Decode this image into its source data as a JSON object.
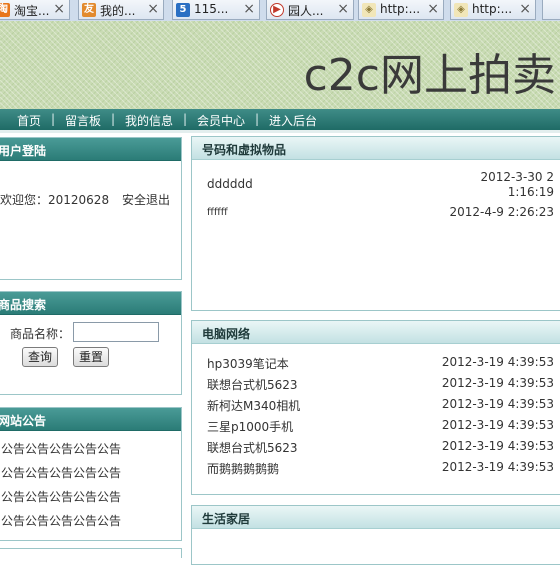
{
  "browser": {
    "tabs": [
      {
        "label": "淘宝...",
        "icon": "taobao-icon",
        "color": "#e8761b",
        "glyph": "淘"
      },
      {
        "label": "我的...",
        "icon": "browser-favicon-icon",
        "color": "#e28a2d",
        "glyph": "友"
      },
      {
        "label": "115...",
        "icon": "115-icon",
        "color": "#2a6fc3",
        "glyph": "5"
      },
      {
        "label": "园人...",
        "icon": "video-play-icon",
        "color": "#ffffff",
        "glyph": "▶"
      },
      {
        "label": "http:...",
        "icon": "cube-icon",
        "color": "#8c7a38",
        "glyph": "◈"
      },
      {
        "label": "http:...",
        "icon": "cube-icon",
        "color": "#8c7a38",
        "glyph": "◈"
      }
    ],
    "close_glyph": "×"
  },
  "header": {
    "title": "c2c网上拍卖"
  },
  "nav": {
    "items": [
      "首页",
      "留言板",
      "我的信息",
      "会员中心",
      "进入后台"
    ],
    "separator": "|"
  },
  "login": {
    "title": "用户登陆",
    "welcome": "欢迎您：20120628",
    "logout": "安全退出"
  },
  "search": {
    "title": "商品搜索",
    "label": "商品名称：",
    "value": "",
    "query_button": "查询",
    "reset_button": "重置"
  },
  "announcements": {
    "title": "网站公告",
    "items": [
      "公告公告公告公告公告",
      "公告公告公告公告公告",
      "公告公告公告公告公告",
      "公告公告公告公告公告"
    ]
  },
  "categories": [
    {
      "title": "号码和虚拟物品",
      "items": [
        {
          "name": "dddddd",
          "date": "2012-3-30 21:16:19"
        },
        {
          "name": "ffffff",
          "date": "2012-4-9 2:26:23"
        }
      ]
    },
    {
      "title": "电脑网络",
      "items": [
        {
          "name": "hp3039笔记本",
          "date": "2012-3-19 4:39:53"
        },
        {
          "name": "联想台式机5623",
          "date": "2012-3-19 4:39:53"
        },
        {
          "name": "新柯达M340相机",
          "date": "2012-3-19 4:39:53"
        },
        {
          "name": "三星p1000手机",
          "date": "2012-3-19 4:39:53"
        },
        {
          "name": "联想台式机5623",
          "date": "2012-3-19 4:39:53"
        },
        {
          "name": "而鹅鹅鹅鹅鹅",
          "date": "2012-3-19 4:39:53"
        }
      ]
    },
    {
      "title": "生活家居",
      "items": []
    }
  ],
  "colors": {
    "nav_bar": "#2b7c77",
    "panel_border": "#9cc6c8",
    "header_bg": "#c9dbb4"
  }
}
